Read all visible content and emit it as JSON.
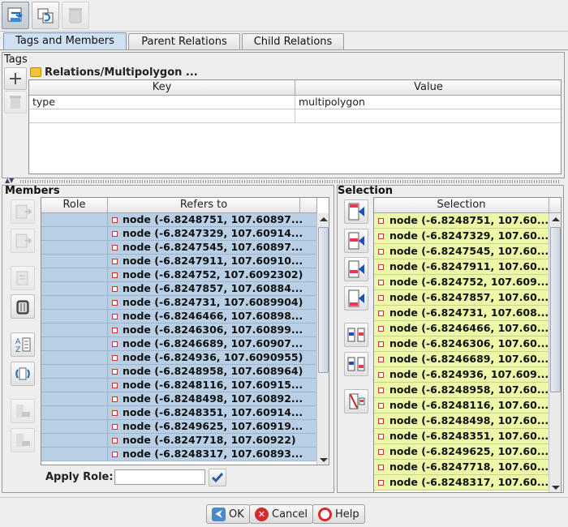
{
  "toolbar": {
    "buttons": [
      {
        "icon": "apply-icon",
        "pressed": true
      },
      {
        "icon": "refresh-icon",
        "pressed": false
      },
      {
        "icon": "delete-icon",
        "pressed": false,
        "disabled": true
      }
    ]
  },
  "tabs": [
    {
      "label": "Tags and Members",
      "active": true
    },
    {
      "label": "Parent Relations",
      "active": false
    },
    {
      "label": "Child Relations",
      "active": false
    }
  ],
  "tags": {
    "section_title": "Tags",
    "relation_label": "Relations/Multipolygon ...",
    "columns": [
      "Key",
      "Value"
    ],
    "rows": [
      {
        "key": "type",
        "value": "multipolygon"
      },
      {
        "key": "",
        "value": ""
      }
    ]
  },
  "members": {
    "section_title": "Members",
    "columns": [
      "Role",
      "Refers to"
    ],
    "rows": [
      "node (-6.8248751, 107.60897...",
      "node (-6.8247329, 107.60914...",
      "node (-6.8247545, 107.60897...",
      "node (-6.8247911, 107.60910...",
      "node (-6.824752, 107.6092302)",
      "node (-6.8247857, 107.60884...",
      "node (-6.824731, 107.6089904)",
      "node (-6.8246466, 107.60898...",
      "node (-6.8246306, 107.60899...",
      "node (-6.8246689, 107.60907...",
      "node (-6.824936, 107.6090955)",
      "node (-6.8248958, 107.608964)",
      "node (-6.8248116, 107.60915...",
      "node (-6.8248498, 107.60892...",
      "node (-6.8248351, 107.60914...",
      "node (-6.8249625, 107.60919...",
      "node (-6.8247718, 107.60922)",
      "node (-6.8248317, 107.60893..."
    ],
    "apply_role_label": "Apply Role:",
    "apply_role_value": ""
  },
  "selection": {
    "section_title": "Selection",
    "column": "Selection",
    "rows": [
      "node (-6.8248751, 107.60...",
      "node (-6.8247329, 107.60...",
      "node (-6.8247545, 107.60...",
      "node (-6.8247911, 107.60...",
      "node (-6.824752, 107.609...",
      "node (-6.8247857, 107.60...",
      "node (-6.824731, 107.608...",
      "node (-6.8246466, 107.60...",
      "node (-6.8246306, 107.60...",
      "node (-6.8246689, 107.60...",
      "node (-6.824936, 107.609...",
      "node (-6.8248958, 107.60...",
      "node (-6.8248116, 107.60...",
      "node (-6.8248498, 107.60...",
      "node (-6.8248351, 107.60...",
      "node (-6.8249625, 107.60...",
      "node (-6.8247718, 107.60...",
      "node (-6.8248317, 107.60..."
    ]
  },
  "buttons": {
    "ok": "OK",
    "cancel": "Cancel",
    "help": "Help"
  },
  "colors": {
    "members_row_bg": "#b8cfe5",
    "selection_row_bg": "#ecf7a8",
    "active_tab": "#cfe0f0"
  }
}
